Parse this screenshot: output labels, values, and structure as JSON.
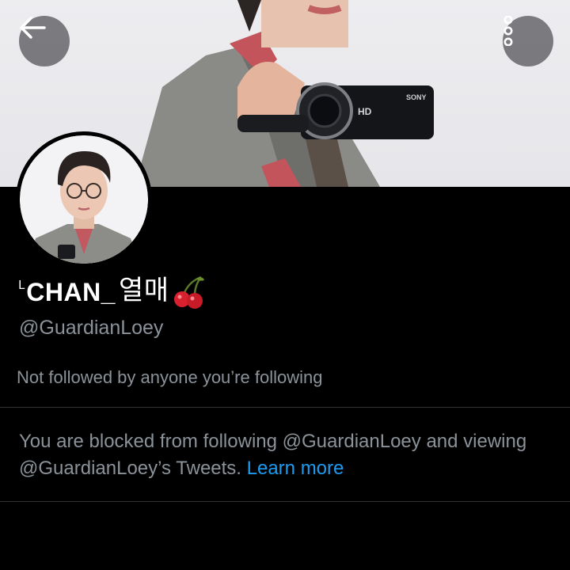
{
  "header": {
    "back_icon": "arrow-left-icon",
    "more_icon": "more-vertical-icon"
  },
  "banner": {
    "camera_brand": "SONY",
    "camera_hd_label": "HD"
  },
  "profile": {
    "name_prefix": "ᴸ",
    "name_main": "CHAN_",
    "name_hangul": "열매",
    "name_emoji": "cherry-icon",
    "handle": "@GuardianLoey",
    "follow_info": "Not followed by anyone you’re following"
  },
  "blocked": {
    "message": "You are blocked from following @GuardianLoey and viewing @GuardianLoey’s Tweets.",
    "learn_more": "Learn more"
  },
  "colors": {
    "background": "#000000",
    "secondary_text": "#8b9299",
    "link": "#1d9bf0",
    "divider": "#2f3336"
  }
}
